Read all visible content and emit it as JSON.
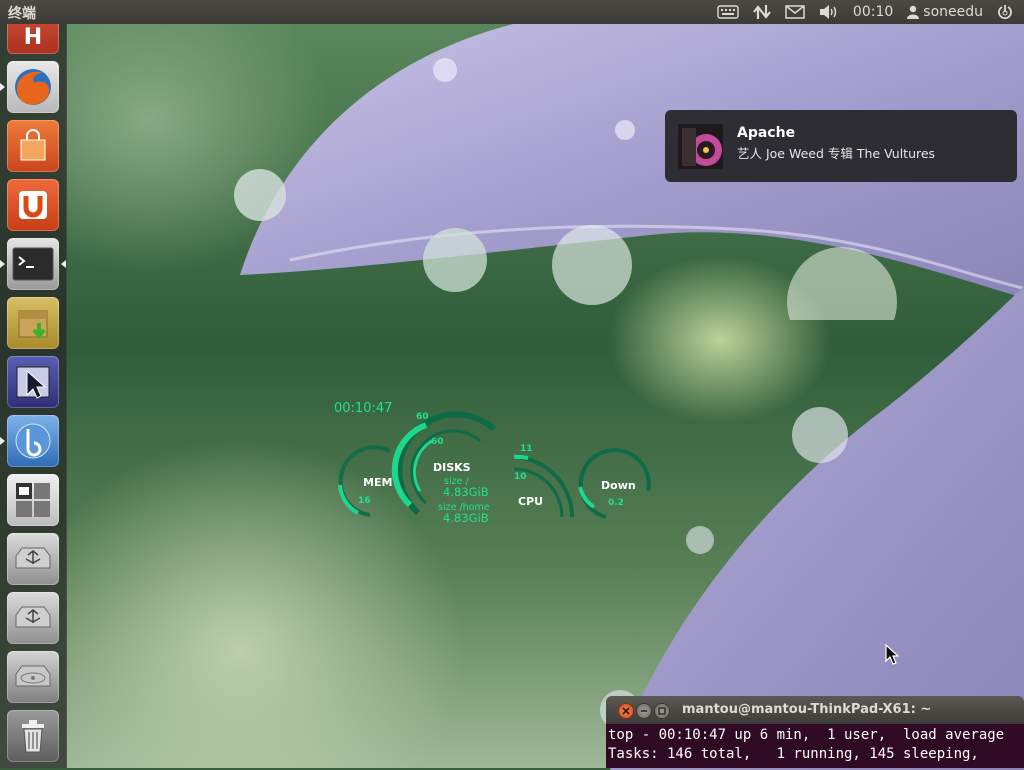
{
  "top_panel": {
    "app_title": "终端",
    "clock": "00:10",
    "user": "soneedu",
    "icons": [
      "keyboard-icon",
      "network-icon",
      "mail-icon",
      "volume-icon",
      "user-icon",
      "power-icon"
    ]
  },
  "launcher": {
    "items": [
      {
        "name": "unknown-app",
        "color": "#c0392b"
      },
      {
        "name": "firefox",
        "color": "#e56a1f"
      },
      {
        "name": "ubuntu-software-center",
        "color": "#e05a20"
      },
      {
        "name": "ubuntu-one",
        "color": "#dd4814"
      },
      {
        "name": "terminal",
        "color": "#2b2b2b"
      },
      {
        "name": "archive-manager",
        "color": "#c8a848"
      },
      {
        "name": "pointer-app",
        "color": "#3d3f8f"
      },
      {
        "name": "banshee",
        "color": "#3b78c4"
      },
      {
        "name": "workspace-switcher",
        "color": "#d8d8d8"
      },
      {
        "name": "usb-drive-1",
        "color": "#9a9a9a"
      },
      {
        "name": "usb-drive-2",
        "color": "#9a9a9a"
      },
      {
        "name": "hard-disk",
        "color": "#8a8a8a"
      },
      {
        "name": "trash",
        "color": "#7a7a7a"
      }
    ]
  },
  "notification": {
    "title": "Apache",
    "body": "艺人 Joe Weed 专辑 The Vultures"
  },
  "conky": {
    "time": "00:10:47",
    "mem_label": "MEM",
    "mem_value": "16",
    "disks_label": "DISKS",
    "disks_num1": "60",
    "disks_num2": "60",
    "size_root_label": "size /",
    "size_root_value": "4.83GiB",
    "size_home_label": "size /home",
    "size_home_value": "4.83GiB",
    "cpu_label": "CPU",
    "cpu_num1": "11",
    "cpu_num2": "10",
    "down_label": "Down",
    "down_value": "0.2"
  },
  "terminal": {
    "title": "mantou@mantou-ThinkPad-X61: ~",
    "lines": [
      "top - 00:10:47 up 6 min,  1 user,  load average",
      "Tasks: 146 total,   1 running, 145 sleeping,"
    ]
  },
  "colors": {
    "panel": "#3c3b37",
    "conky_green": "#22e08f",
    "terminal_bg": "#300a24",
    "close_button": "#e25d33"
  }
}
